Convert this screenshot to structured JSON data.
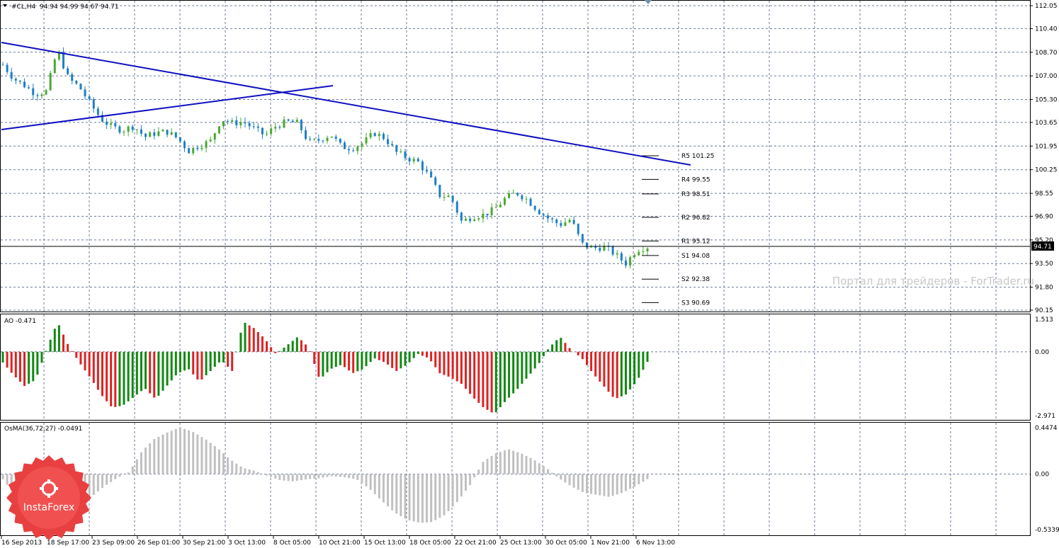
{
  "chart_header": {
    "symbol_label": "#CL,H4",
    "ohlc_text": "94.94 94.99 94.67 94.71"
  },
  "watermark": "Портал для трейдеров - ForTrader.ru",
  "logo_text": "InstaForex",
  "current_price_label": "94.71",
  "colors": {
    "bull_candle": "#4aa832",
    "bear_candle": "#1f7fc4",
    "trendline": "#1010c0",
    "ao_up": "#118811",
    "ao_down": "#dd2222",
    "osma": "#c0c0c0",
    "grid": "#6b7b9b",
    "logo_red": "#e84040"
  },
  "pivots": [
    {
      "label": "R5 101.25",
      "value": 101.25
    },
    {
      "label": "R4 99.55",
      "value": 99.55
    },
    {
      "label": "R3 98.51",
      "value": 98.51
    },
    {
      "label": "R2 96.82",
      "value": 96.82
    },
    {
      "label": "R1 95.12",
      "value": 95.12
    },
    {
      "label": "S1 94.08",
      "value": 94.08
    },
    {
      "label": "S2 92.38",
      "value": 92.38
    },
    {
      "label": "S3 90.69",
      "value": 90.69
    }
  ],
  "chart_data": [
    {
      "type": "candlestick",
      "title": "#CL,H4",
      "y_ticks": [
        "112.05",
        "110.40",
        "108.70",
        "107.00",
        "105.30",
        "103.65",
        "101.95",
        "100.25",
        "98.55",
        "96.90",
        "95.20",
        "93.50",
        "91.80",
        "90.15"
      ],
      "ylim": [
        90.15,
        112.05
      ],
      "price_path": [
        107.8,
        106.8,
        106.3,
        105.7,
        105.9,
        108.9,
        106.8,
        106.2,
        105.0,
        103.9,
        103.3,
        103.1,
        103.4,
        102.6,
        102.9,
        103.0,
        102.5,
        101.6,
        102.0,
        102.3,
        103.9,
        103.6,
        103.7,
        103.2,
        102.7,
        103.4,
        103.7,
        103.6,
        102.2,
        102.4,
        102.8,
        101.9,
        101.8,
        102.2,
        102.9,
        102.5,
        101.5,
        101.1,
        100.8,
        99.8,
        98.4,
        98.3,
        96.5,
        96.9,
        97.0,
        97.4,
        98.2,
        98.6,
        98.1,
        97.3,
        96.7,
        96.3,
        96.7,
        94.9,
        94.6,
        94.7,
        94.2,
        93.5,
        94.5,
        94.71
      ],
      "current_price": 94.71
    },
    {
      "type": "histogram",
      "title": "AO -0.471",
      "y_ticks": [
        "1.513",
        "0.00",
        "-2.971"
      ],
      "ylim": [
        -2.971,
        1.513
      ],
      "values": [
        -0.5,
        -1.1,
        -1.6,
        -1.3,
        0.1,
        1.4,
        0.3,
        -0.5,
        -1.2,
        -2.0,
        -2.6,
        -2.5,
        -2.1,
        -1.7,
        -2.2,
        -1.6,
        -1.0,
        -0.8,
        -1.4,
        -0.9,
        -0.4,
        -0.9,
        1.4,
        1.1,
        0.6,
        -0.1,
        0.3,
        0.7,
        0.2,
        -1.3,
        -0.8,
        -0.6,
        -1.0,
        -0.8,
        -0.3,
        -0.5,
        -0.9,
        -0.6,
        -0.1,
        -0.3,
        -1.0,
        -1.2,
        -1.5,
        -2.1,
        -2.6,
        -2.9,
        -2.3,
        -1.8,
        -1.2,
        -0.6,
        0.2,
        0.7,
        0.1,
        -0.3,
        -1.0,
        -1.6,
        -2.2,
        -2.0,
        -1.4,
        -0.471
      ]
    },
    {
      "type": "histogram",
      "title": "OsMA(36,72,27) -0.0491",
      "y_ticks": [
        "0.4474",
        "0.00",
        "-0.5339"
      ],
      "ylim": [
        -0.5339,
        0.4474
      ],
      "values": [
        -0.05,
        -0.2,
        -0.35,
        -0.48,
        -0.46,
        -0.4,
        -0.32,
        -0.22,
        -0.12,
        -0.04,
        0.02,
        0.22,
        0.34,
        0.4,
        0.45,
        0.41,
        0.34,
        0.25,
        0.14,
        0.06,
        0.03,
        -0.02,
        -0.06,
        -0.07,
        -0.05,
        -0.04,
        -0.02,
        -0.03,
        -0.05,
        -0.14,
        -0.26,
        -0.37,
        -0.44,
        -0.47,
        -0.46,
        -0.39,
        -0.26,
        -0.1,
        0.12,
        0.2,
        0.24,
        0.2,
        0.14,
        0.06,
        -0.04,
        -0.12,
        -0.18,
        -0.2,
        -0.22,
        -0.18,
        -0.12,
        -0.0491
      ]
    }
  ],
  "x_ticks": [
    "16 Sep 2013",
    "18 Sep 17:00",
    "23 Sep 09:00",
    "26 Sep 01:00",
    "30 Sep 21:00",
    "3 Oct 13:00",
    "8 Oct 05:00",
    "10 Oct 21:00",
    "15 Oct 13:00",
    "18 Oct 05:00",
    "22 Oct 21:00",
    "25 Oct 13:00",
    "30 Oct 05:00",
    "1 Nov 21:00",
    "6 Nov 13:00"
  ]
}
